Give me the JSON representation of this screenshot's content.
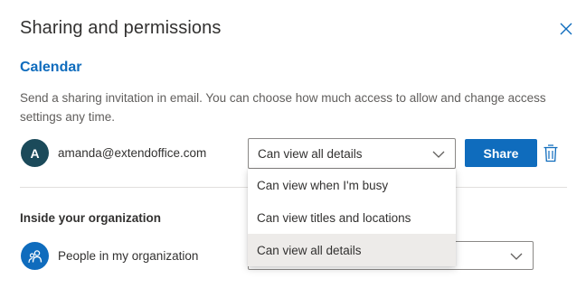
{
  "dialog": {
    "title": "Sharing and permissions"
  },
  "calendar": {
    "section_title": "Calendar",
    "description": "Send a sharing invitation in email. You can choose how much access to allow and change access settings any time."
  },
  "invitee": {
    "avatar_initial": "A",
    "email": "amanda@extendoffice.com",
    "permission_selected": "Can view all details",
    "share_label": "Share"
  },
  "permission_menu": {
    "options": [
      {
        "label": "Can view when I'm busy",
        "selected": false
      },
      {
        "label": "Can view titles and locations",
        "selected": false
      },
      {
        "label": "Can view all details",
        "selected": true
      }
    ]
  },
  "organization": {
    "heading": "Inside your organization",
    "name": "People in my organization"
  },
  "colors": {
    "accent": "#0f6cbd",
    "avatar_bg": "#1b4a5a",
    "menu_selected_bg": "#edebe9"
  },
  "icons": {
    "close": "close-icon",
    "chevron": "chevron-down-icon",
    "delete": "trash-icon",
    "people": "people-icon"
  }
}
